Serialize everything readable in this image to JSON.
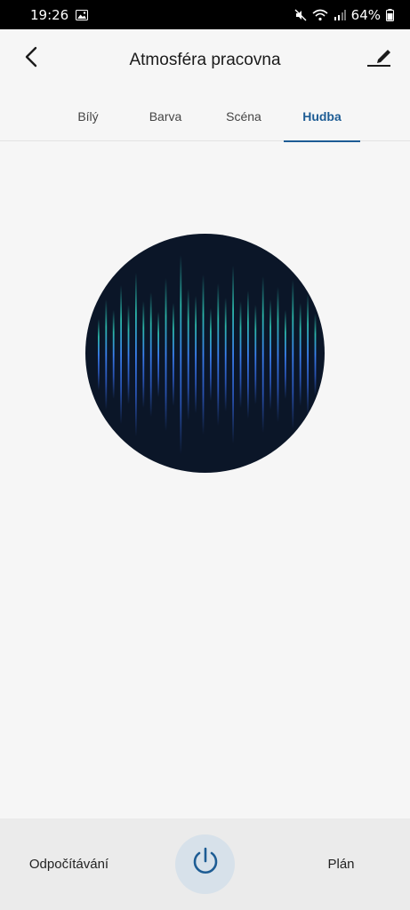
{
  "status_bar": {
    "time": "19:26",
    "battery": "64%",
    "icons": [
      "gallery-icon",
      "mute-icon",
      "wifi-icon",
      "signal-icon",
      "battery-icon"
    ]
  },
  "header": {
    "title": "Atmosféra pracovna",
    "back_icon": "chevron-left-icon",
    "edit_icon": "pencil-icon"
  },
  "tabs": [
    {
      "label": "Bílý",
      "active": false
    },
    {
      "label": "Barva",
      "active": false
    },
    {
      "label": "Scéna",
      "active": false
    },
    {
      "label": "Hudba",
      "active": true
    }
  ],
  "colors": {
    "accent": "#1d5c94",
    "circle_bg": "#0b1628",
    "wave_blue": "#2f6fe0",
    "wave_teal": "#2ec7b6"
  },
  "bottom_bar": {
    "countdown_label": "Odpočítávání",
    "schedule_label": "Plán",
    "power_icon": "power-icon"
  }
}
